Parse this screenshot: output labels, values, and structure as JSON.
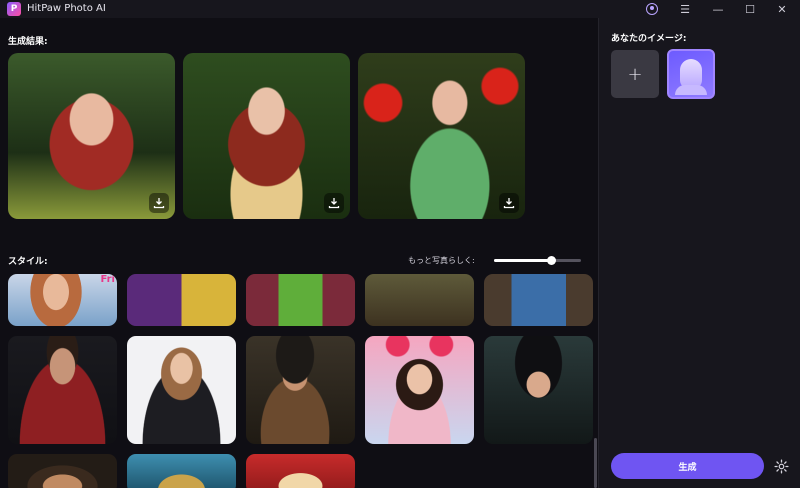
{
  "app": {
    "title": "HitPaw Photo AI",
    "logo_letter": "P"
  },
  "titlebar_icons": [
    "account-icon",
    "menu-icon",
    "minimize-icon",
    "maximize-icon",
    "close-icon"
  ],
  "results": {
    "label": "生成結果:",
    "items": [
      {
        "name": "result-1",
        "download_icon": "download-icon"
      },
      {
        "name": "result-2",
        "download_icon": "download-icon"
      },
      {
        "name": "result-3",
        "download_icon": "download-icon"
      }
    ]
  },
  "styles": {
    "label": "スタイル:",
    "realism_label": "もっと写真らしく:",
    "realism_value": 0.65,
    "thumbnails_text": [
      "Fri"
    ]
  },
  "sidebar": {
    "your_image_label": "あなたのイメージ:",
    "add_label": "+",
    "generate_label": "生成",
    "settings_icon": "gear-icon"
  },
  "colors": {
    "accent": "#6f55f2",
    "accent_border": "#a186ff",
    "bg": "#0f0e14",
    "panel": "#17161d"
  }
}
